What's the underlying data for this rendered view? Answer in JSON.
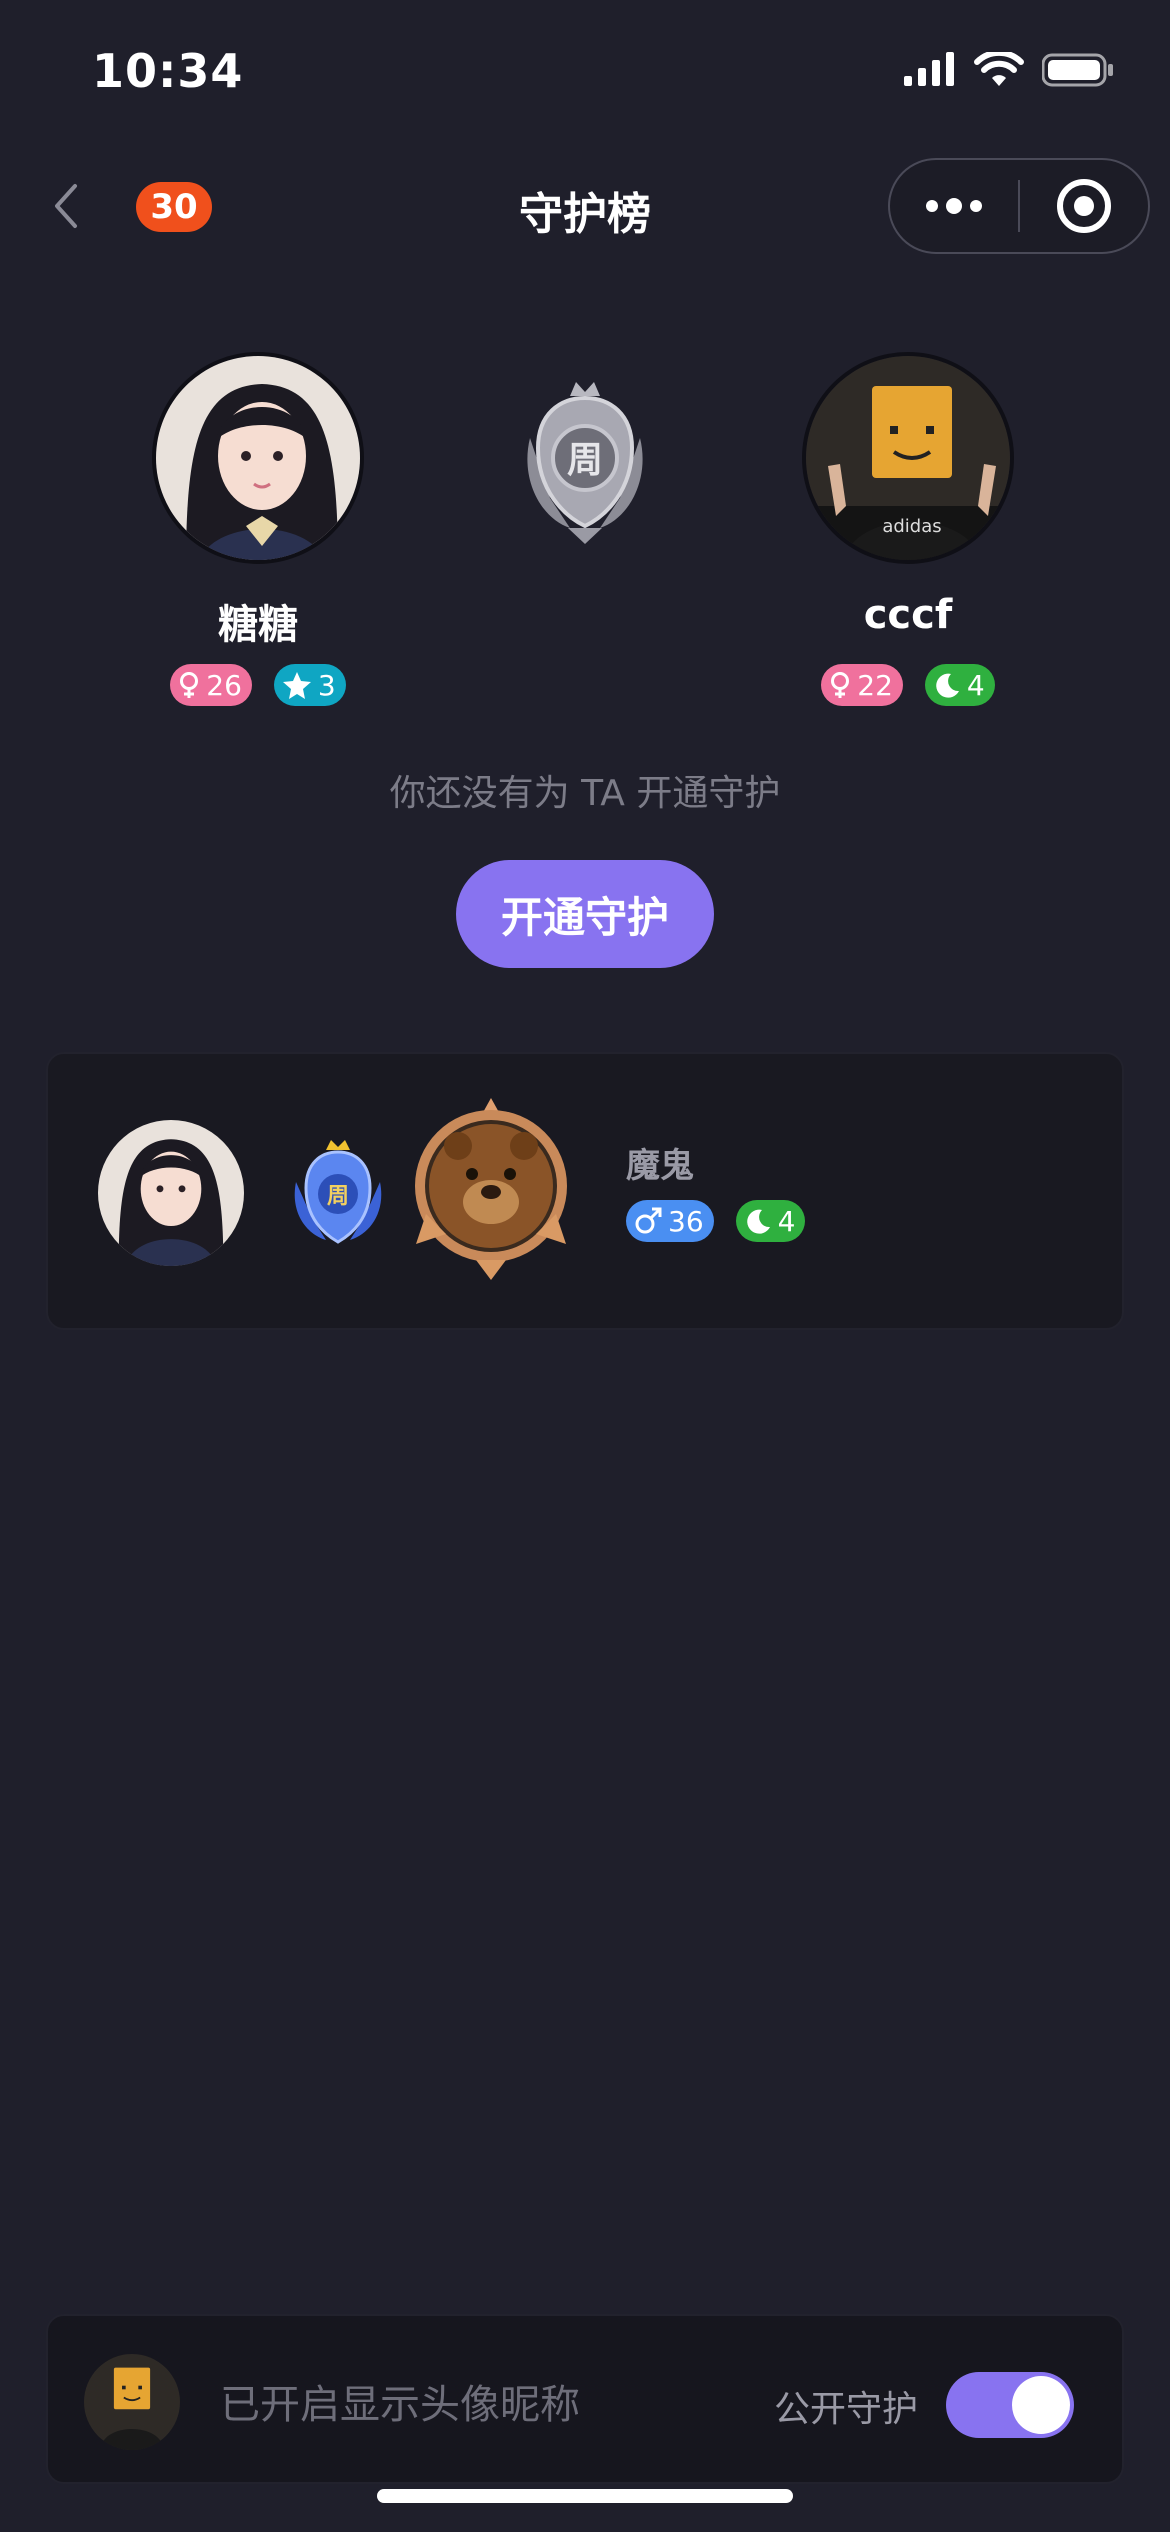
{
  "status_bar": {
    "time": "10:34"
  },
  "nav": {
    "badge_count": "30",
    "title": "守护榜"
  },
  "pair": {
    "left": {
      "name": "糖糖",
      "gender_age": "26",
      "level": "3"
    },
    "right": {
      "name": "cccf",
      "gender_age": "22",
      "level": "4"
    }
  },
  "empty_text": "你还没有为 TA 开通守护",
  "open_button_label": "开通守护",
  "card": {
    "name": "魔鬼",
    "gender_age": "36",
    "level": "4"
  },
  "bottom": {
    "text": "已开启显示头像昵称",
    "toggle_label": "公开守护",
    "toggle_on": true
  },
  "colors": {
    "accent": "#8873f0",
    "badge": "#f0501c",
    "background": "#1f1f2b"
  }
}
